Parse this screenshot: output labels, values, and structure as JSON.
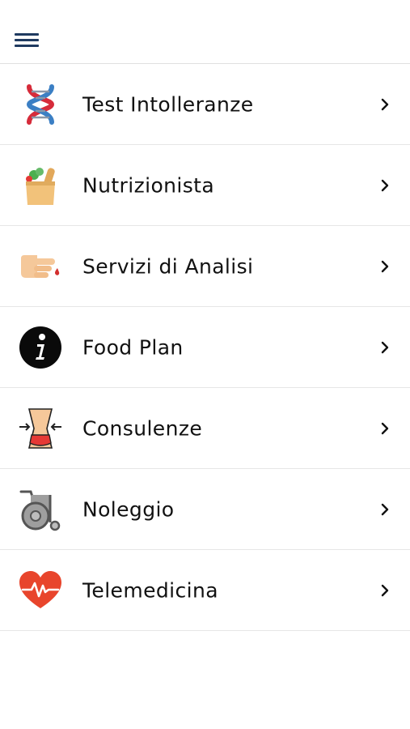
{
  "header": {
    "menu_icon": "hamburger-icon",
    "icon_color": "#1f3a60"
  },
  "menu": {
    "items": [
      {
        "label": "Test Intolleranze",
        "icon": "dna-icon"
      },
      {
        "label": "Nutrizionista",
        "icon": "grocery-bag-icon"
      },
      {
        "label": "Servizi di Analisi",
        "icon": "finger-blood-drop-icon"
      },
      {
        "label": "Food Plan",
        "icon": "info-icon"
      },
      {
        "label": "Consulenze",
        "icon": "waist-measure-icon"
      },
      {
        "label": "Noleggio",
        "icon": "wheelchair-icon"
      },
      {
        "label": "Telemedicina",
        "icon": "heart-pulse-icon"
      }
    ],
    "chevron_icon": "chevron-right-icon"
  }
}
